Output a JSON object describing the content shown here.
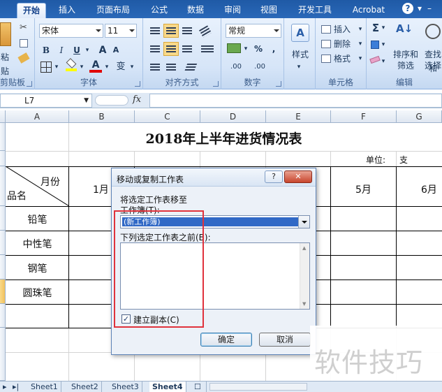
{
  "ribbon_tabs": [
    "开始",
    "插入",
    "页面布局",
    "公式",
    "数据",
    "审阅",
    "视图",
    "开发工具",
    "Acrobat"
  ],
  "active_tab": "开始",
  "help_icon": "help-icon",
  "window_min_icon": "minimize-icon",
  "clipboard": {
    "paste_label": "粘贴",
    "group_label": "剪贴板"
  },
  "font": {
    "name": "宋体",
    "size": "11",
    "group_label": "字体",
    "bold": "B",
    "italic": "I",
    "underline": "U",
    "grow": "A",
    "shrink": "A",
    "font_color": "A",
    "phonetic": "变"
  },
  "alignment": {
    "group_label": "对齐方式"
  },
  "number": {
    "format": "常规",
    "group_label": "数字",
    "percent": "%",
    "comma": ",",
    "inc_decimal": ".00",
    "dec_decimal": ".00"
  },
  "styles": {
    "label": "样式"
  },
  "cells": {
    "insert": "插入",
    "delete": "删除",
    "format": "格式",
    "group_label": "单元格"
  },
  "editing": {
    "sum": "Σ",
    "sort_filter": "排序和\n筛选",
    "sort_top": "排序和",
    "sort_bottom": "筛选",
    "find_top": "查找和",
    "find_bottom": "选择",
    "group_label": "编辑"
  },
  "formula_bar": {
    "name_box": "L7",
    "fx": "fx",
    "formula": ""
  },
  "columns": [
    "A",
    "B",
    "C",
    "D",
    "E",
    "F",
    "G"
  ],
  "sheet": {
    "title": "2018年上半年进货情况表",
    "unit_label": "单位:",
    "unit_value": "支",
    "header_month": "月份",
    "header_name": "品名",
    "months": [
      "1月",
      "5月",
      "6月"
    ],
    "items": [
      "铅笔",
      "中性笔",
      "钢笔",
      "圆珠笔"
    ]
  },
  "sheet_tabs": [
    "Sheet1",
    "Sheet2",
    "Sheet3",
    "Sheet4"
  ],
  "active_sheet": "Sheet4",
  "dialog": {
    "title": "移动或复制工作表",
    "help": "?",
    "close": "✕",
    "move_label": "将选定工作表移至",
    "workbook_label": "工作簿(T):",
    "workbook_value": "(新工作簿)",
    "before_label": "下列选定工作表之前(B):",
    "copy_label": "建立副本(C)",
    "copy_checked": "✓",
    "ok": "确定",
    "cancel": "取消"
  },
  "watermark": "软件技巧"
}
